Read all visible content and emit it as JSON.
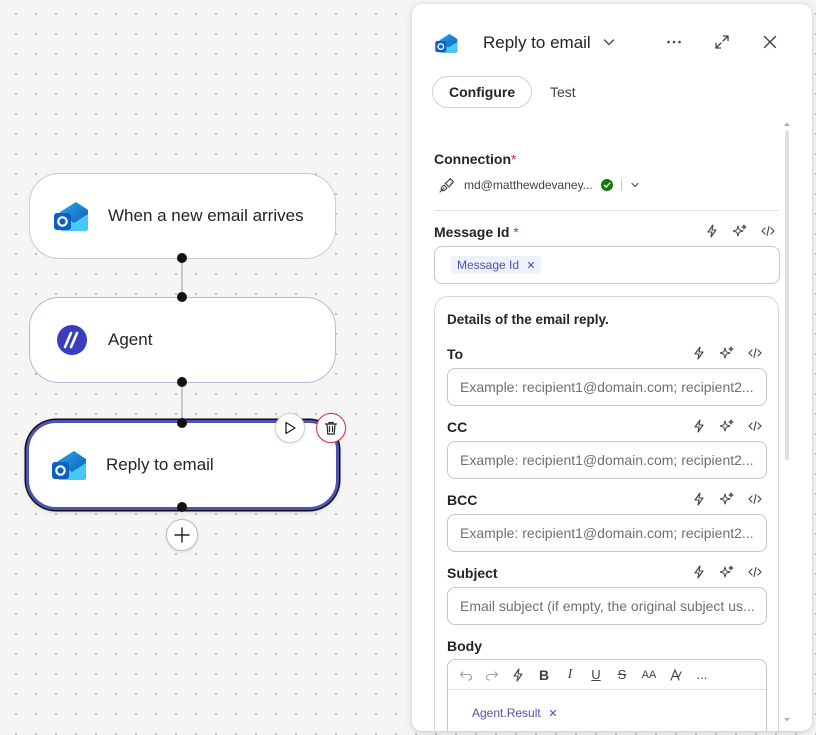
{
  "canvas": {
    "nodes": [
      {
        "label": "When a new email arrives",
        "icon": "outlook-icon"
      },
      {
        "label": "Agent",
        "icon": "agent-icon"
      },
      {
        "label": "Reply to email",
        "icon": "outlook-icon"
      }
    ],
    "add_step_icon": "plus-icon",
    "run_icon": "play-icon",
    "delete_icon": "trash-icon"
  },
  "panel": {
    "title": "Reply to email",
    "tabs": [
      {
        "label": "Configure",
        "active": true
      },
      {
        "label": "Test",
        "active": false
      }
    ],
    "connection": {
      "label": "Connection",
      "required_mark": "*",
      "account": "md@matthewdevaney...",
      "status_color": "#107c10"
    },
    "message_id": {
      "label": "Message Id",
      "required_mark": "*",
      "token": "Message Id"
    },
    "details": {
      "heading": "Details of the email reply.",
      "fields": [
        {
          "label": "To",
          "placeholder": "Example: recipient1@domain.com; recipient2..."
        },
        {
          "label": "CC",
          "placeholder": "Example: recipient1@domain.com; recipient2..."
        },
        {
          "label": "BCC",
          "placeholder": "Example: recipient1@domain.com; recipient2..."
        },
        {
          "label": "Subject",
          "placeholder": "Email subject (if empty, the original subject us..."
        }
      ],
      "body": {
        "label": "Body",
        "toolbar": [
          "undo-icon",
          "redo-icon",
          "lightning-icon",
          "B",
          "I",
          "U",
          "S",
          "AA",
          "font-color-icon",
          "..."
        ],
        "token": "Agent.Result"
      }
    }
  },
  "colors": {
    "accent": "#4f52b2",
    "required": "#c4314b",
    "token_text": "#4f52b2"
  }
}
